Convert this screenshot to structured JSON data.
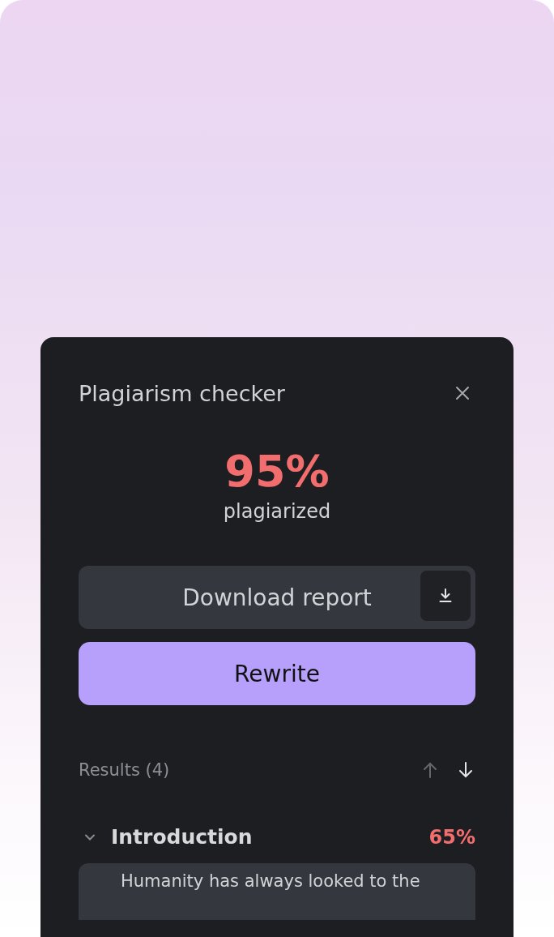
{
  "dialog": {
    "title": "Plagiarism checker"
  },
  "score": {
    "value": "95%",
    "label": "plagiarized"
  },
  "actions": {
    "download": "Download report",
    "rewrite": "Rewrite"
  },
  "results": {
    "heading": "Results (4)",
    "prev_disabled": true,
    "next_disabled": false,
    "sections": [
      {
        "title": "Introduction",
        "score": "65%",
        "expanded": true,
        "excerpt": "Humanity has always looked to the"
      }
    ]
  }
}
